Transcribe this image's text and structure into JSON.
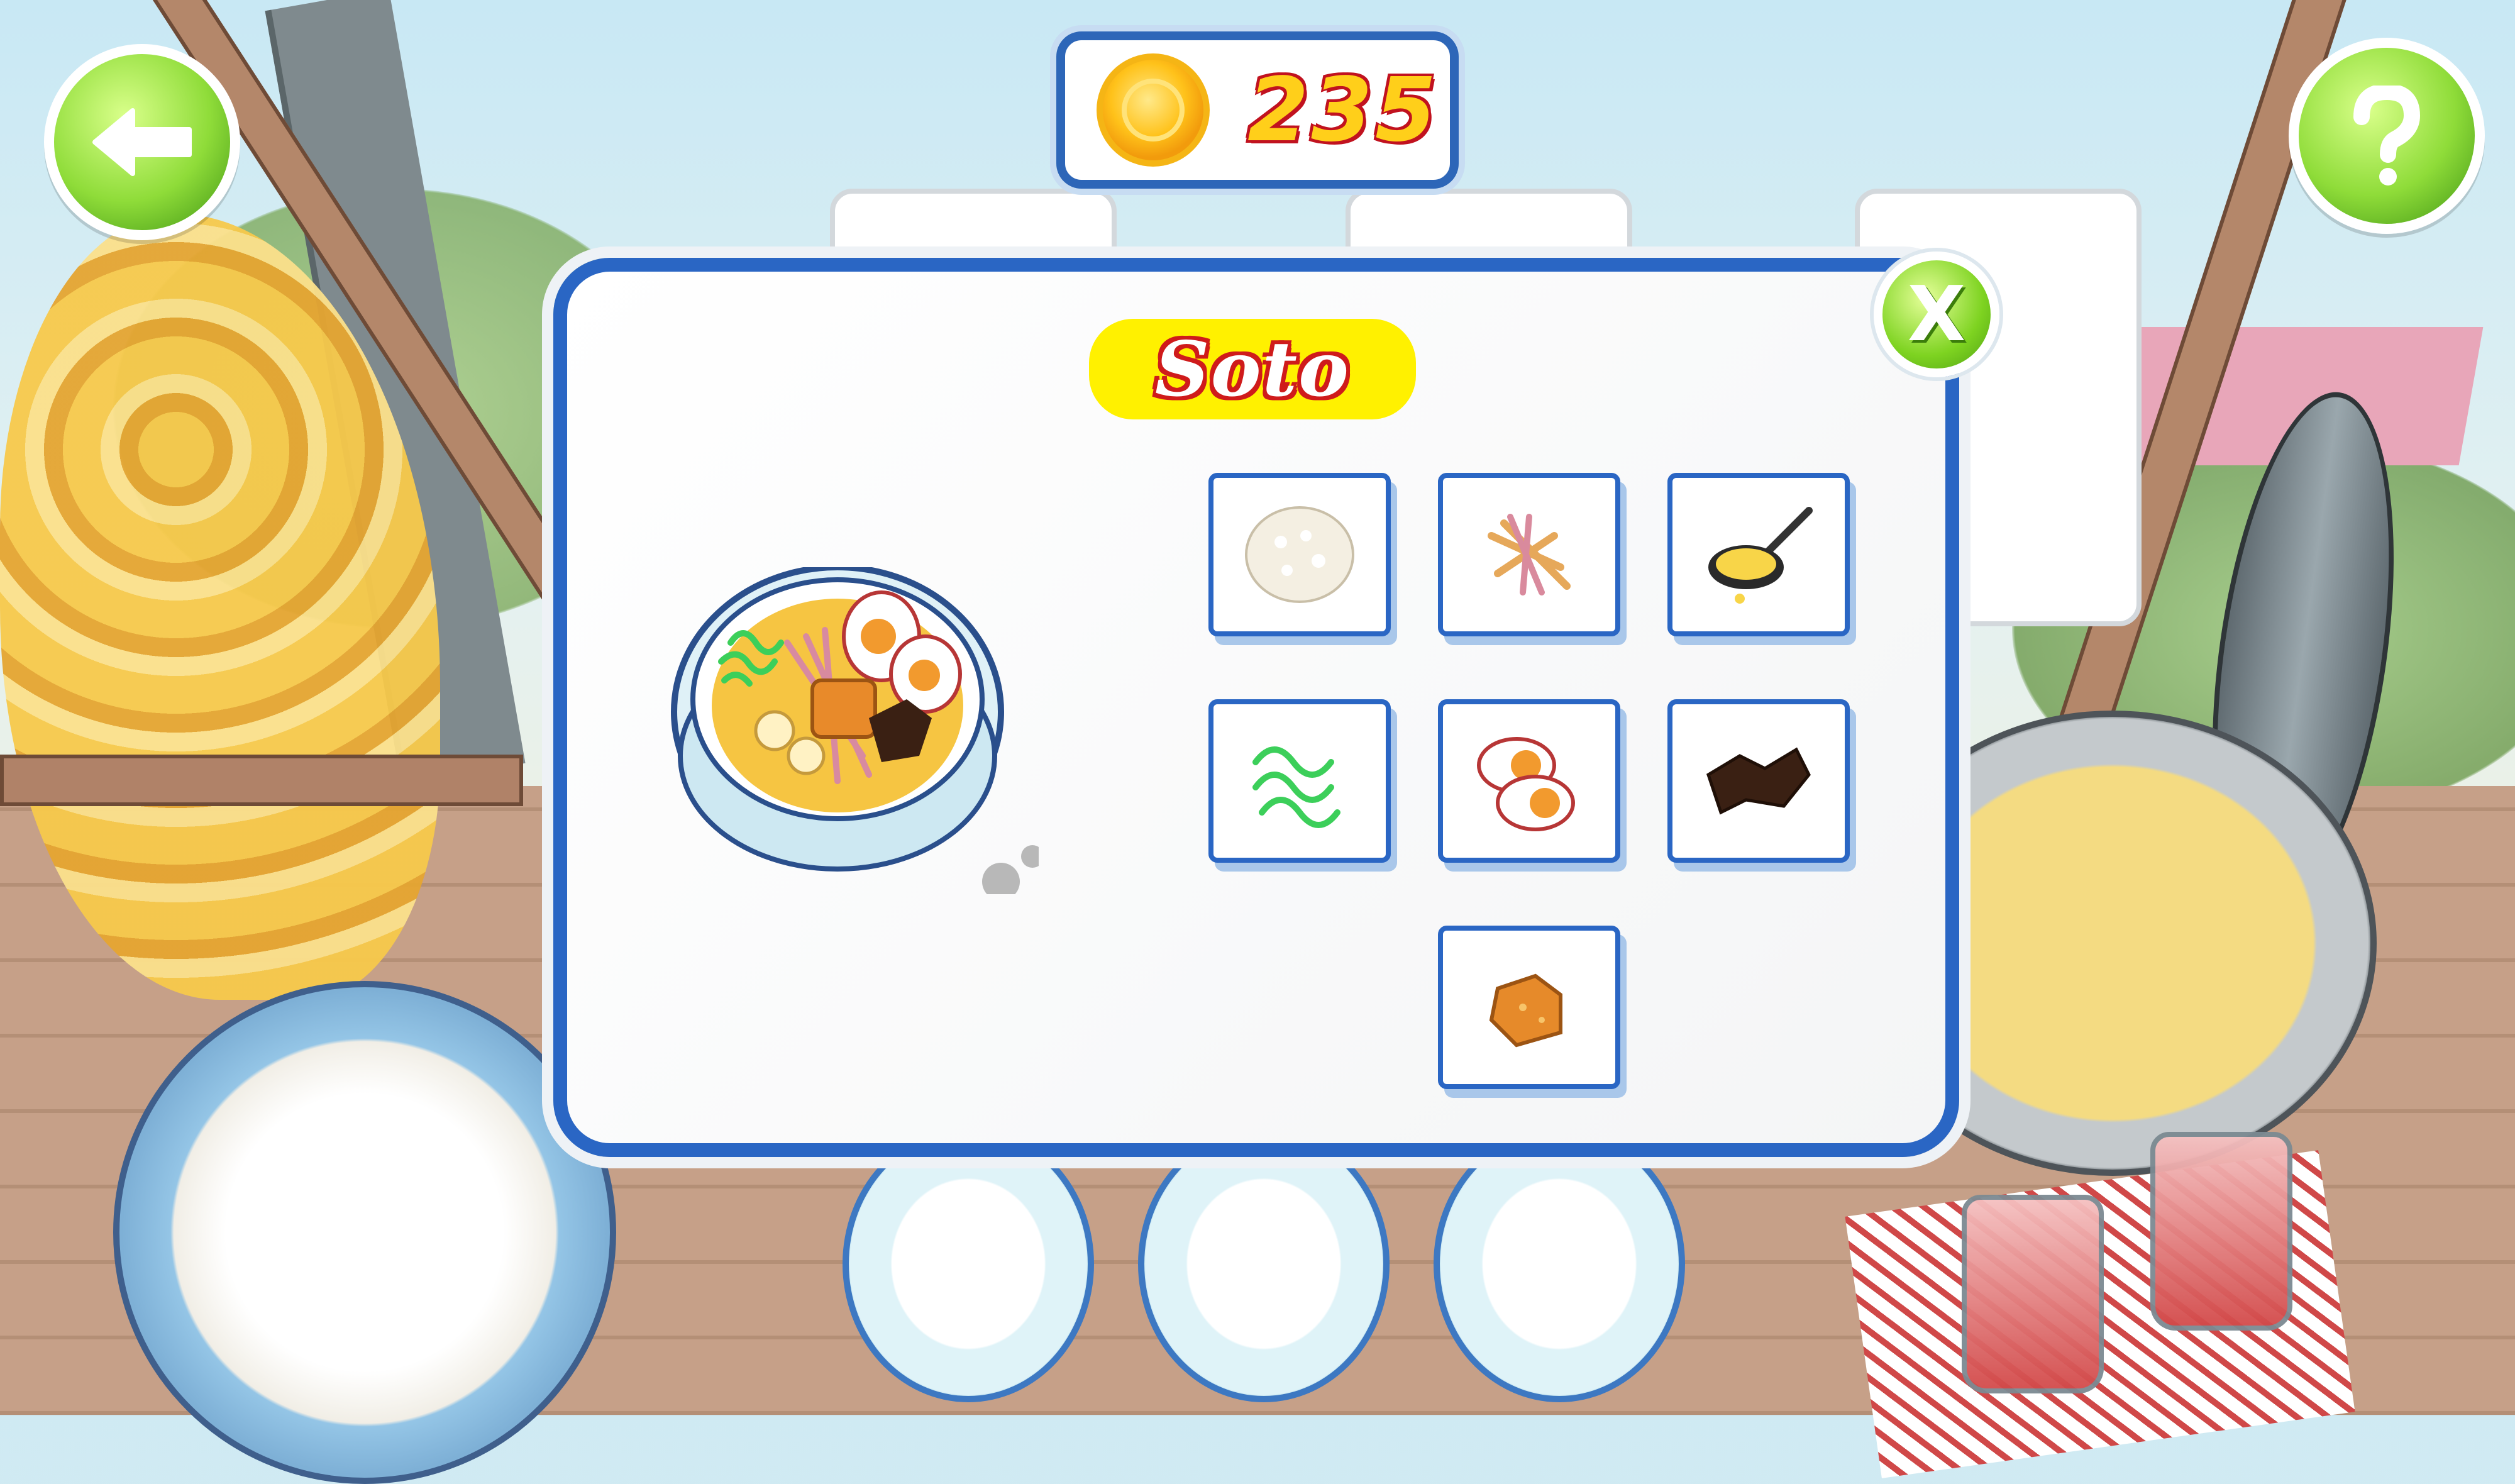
{
  "hud": {
    "coins": "235"
  },
  "recipe": {
    "title": "Soto",
    "ingredients": [
      {
        "icon": "rice-icon"
      },
      {
        "icon": "shredded-chicken-icon"
      },
      {
        "icon": "broth-ladle-icon"
      },
      {
        "icon": "bean-sprouts-icon"
      },
      {
        "icon": "boiled-egg-icon"
      },
      {
        "icon": "fried-potato-icon"
      },
      {
        "icon": "fried-tofu-icon"
      }
    ],
    "close_label": "X"
  },
  "colors": {
    "accent_blue": "#2a66c4",
    "button_green": "#7ed321",
    "title_yellow": "#fff100",
    "title_red": "#cf1b1b",
    "coin_gold": "#ffc21a"
  }
}
